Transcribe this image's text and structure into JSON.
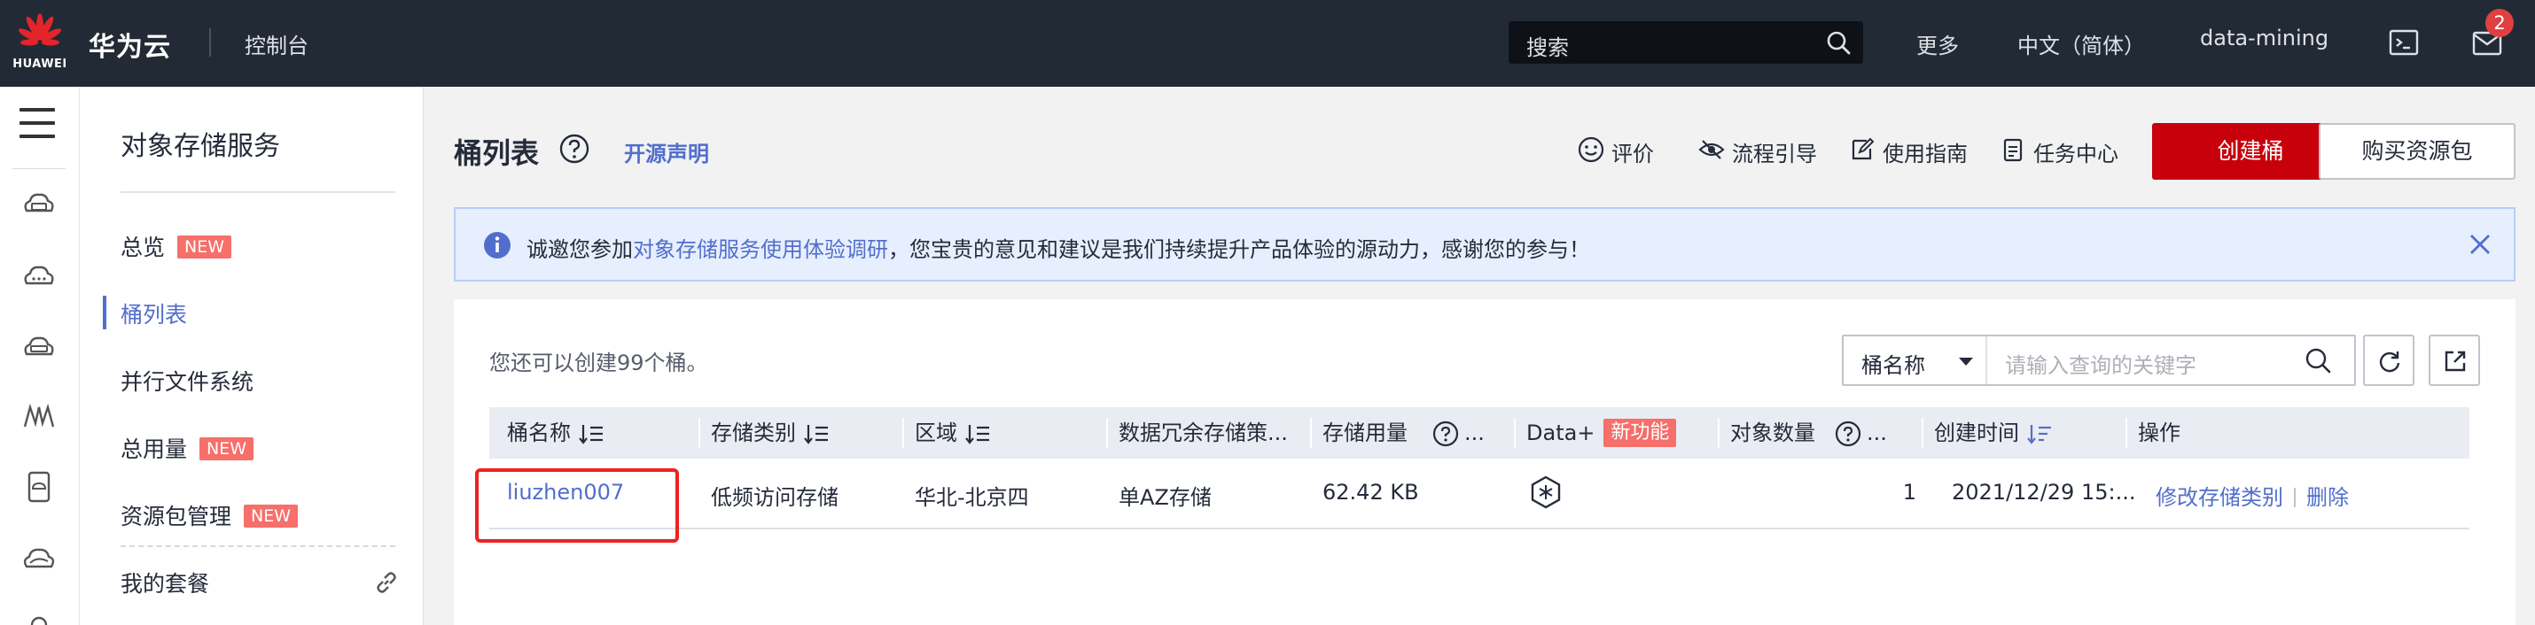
{
  "topbar": {
    "logo_text": "HUAWEI",
    "brand": "华为云",
    "console": "控制台",
    "search_placeholder": "搜索",
    "more": "更多",
    "language": "中文（简体）",
    "user": "data-mining",
    "mail_badge": "2"
  },
  "sidebar": {
    "title": "对象存储服务",
    "items": [
      {
        "label": "总览",
        "badge": "NEW"
      },
      {
        "label": "桶列表"
      },
      {
        "label": "并行文件系统"
      },
      {
        "label": "总用量",
        "badge": "NEW"
      },
      {
        "label": "资源包管理",
        "badge": "NEW"
      },
      {
        "label": "我的套餐"
      }
    ]
  },
  "page": {
    "title": "桶列表",
    "open_source": "开源声明",
    "actions": {
      "rate": "评价",
      "flow_guide": "流程引导",
      "user_guide": "使用指南",
      "task_center": "任务中心"
    },
    "create_bucket": "创建桶",
    "buy_package": "购买资源包"
  },
  "notice": {
    "prefix": "诚邀您参加",
    "link": "对象存储服务使用体验调研",
    "suffix": "，您宝贵的意见和建议是我们持续提升产品体验的源动力，感谢您的参与！"
  },
  "list": {
    "quota_text": "您还可以创建99个桶。",
    "filter_field": "桶名称",
    "filter_placeholder": "请输入查询的关键字",
    "columns": {
      "name": "桶名称",
      "storage_class": "存储类别",
      "region": "区域",
      "redundancy": "数据冗余存储策...",
      "usage": "存储用量",
      "usage_more": "...",
      "data_plus": "Data+",
      "data_plus_badge": "新功能",
      "objects": "对象数量",
      "objects_more": "...",
      "created": "创建时间",
      "ops": "操作"
    },
    "rows": [
      {
        "name": "liuzhen007",
        "storage_class": "低频访问存储",
        "region": "华北-北京四",
        "redundancy": "单AZ存储",
        "usage": "62.42 KB",
        "objects": "1",
        "created": "2021/12/29 15:...",
        "op_modify": "修改存储类别",
        "op_delete": "删除"
      }
    ]
  },
  "colors": {
    "topbar_bg": "#222a35",
    "primary_red": "#c7000b",
    "link_blue": "#526ecc",
    "badge_new": "#f66f6a",
    "highlight_box": "#e22222"
  }
}
